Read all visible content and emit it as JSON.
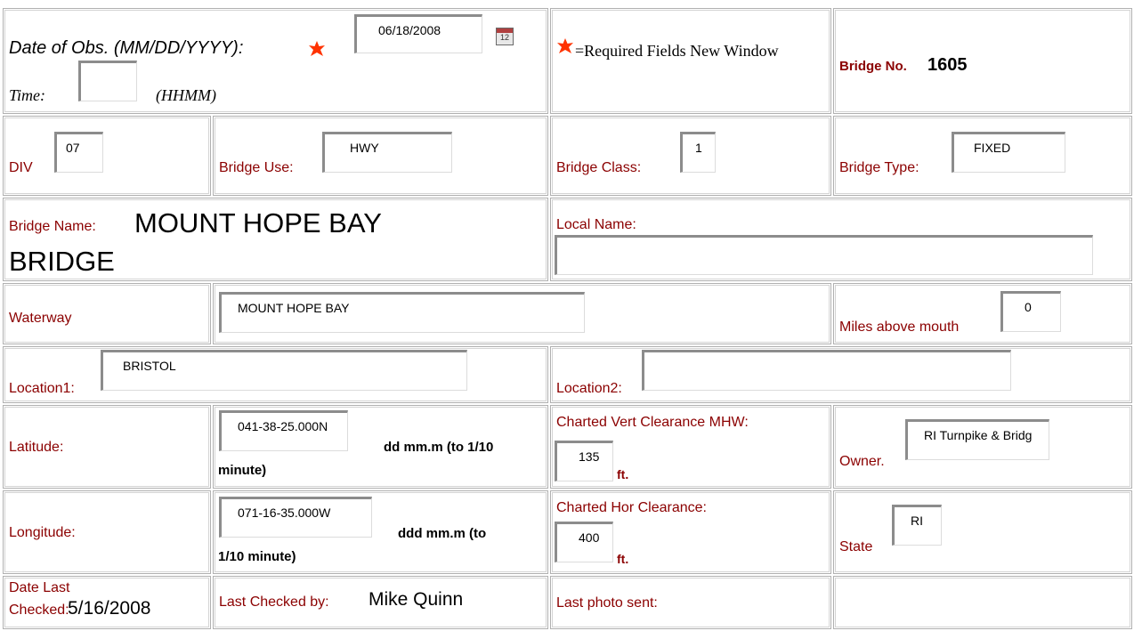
{
  "header": {
    "date_label": "Date of Obs. (MM/DD/YYYY):",
    "date_value": "06/18/2008",
    "time_label": "Time:",
    "time_value": "",
    "time_format": "(HHMM)",
    "required_note": "=Required Fields New Window",
    "bridge_no_label": "Bridge No.",
    "bridge_no_value": "1605"
  },
  "row2": {
    "div_label": "DIV",
    "div_value": "07",
    "use_label": "Bridge Use:",
    "use_value": "HWY",
    "class_label": "Bridge Class:",
    "class_value": "1",
    "type_label": "Bridge Type:",
    "type_value": "FIXED"
  },
  "row3": {
    "name_label": "Bridge Name:",
    "name_line1": "MOUNT HOPE BAY",
    "name_line2": "BRIDGE",
    "local_label": "Local Name:",
    "local_value": ""
  },
  "row4": {
    "waterway_label": "Waterway",
    "waterway_value": "MOUNT HOPE BAY",
    "miles_label": "Miles above mouth",
    "miles_value": "0"
  },
  "row5": {
    "loc1_label": "Location1:",
    "loc1_value": "BRISTOL",
    "loc2_label": "Location2:",
    "loc2_value": ""
  },
  "row6": {
    "lat_label": "Latitude:",
    "lat_value": "041-38-25.000N",
    "lat_hint_a": "dd mm.m (to 1/10",
    "lat_hint_b": "minute)",
    "vert_label": "Charted Vert Clearance MHW:",
    "vert_value": "135",
    "vert_unit": "ft.",
    "owner_label": "Owner.",
    "owner_value": "RI Turnpike & Bridg"
  },
  "row7": {
    "lon_label": "Longitude:",
    "lon_value": "071-16-35.000W",
    "lon_hint_a": "ddd mm.m (to",
    "lon_hint_b": "1/10 minute)",
    "hor_label": "Charted Hor Clearance:",
    "hor_value": "400",
    "hor_unit": "ft.",
    "state_label": "State",
    "state_value": "RI"
  },
  "row8": {
    "last_checked_label_a": "Date Last",
    "last_checked_label_b": "Checked:",
    "last_checked_value": "5/16/2008",
    "checked_by_label": "Last Checked by:",
    "checked_by_value": "Mike Quinn",
    "photo_label": "Last photo sent:"
  },
  "icons": {
    "required": "asterisk-icon",
    "calendar": "calendar-icon"
  },
  "colors": {
    "label": "#8b0000",
    "required_star": "#ff3300"
  }
}
